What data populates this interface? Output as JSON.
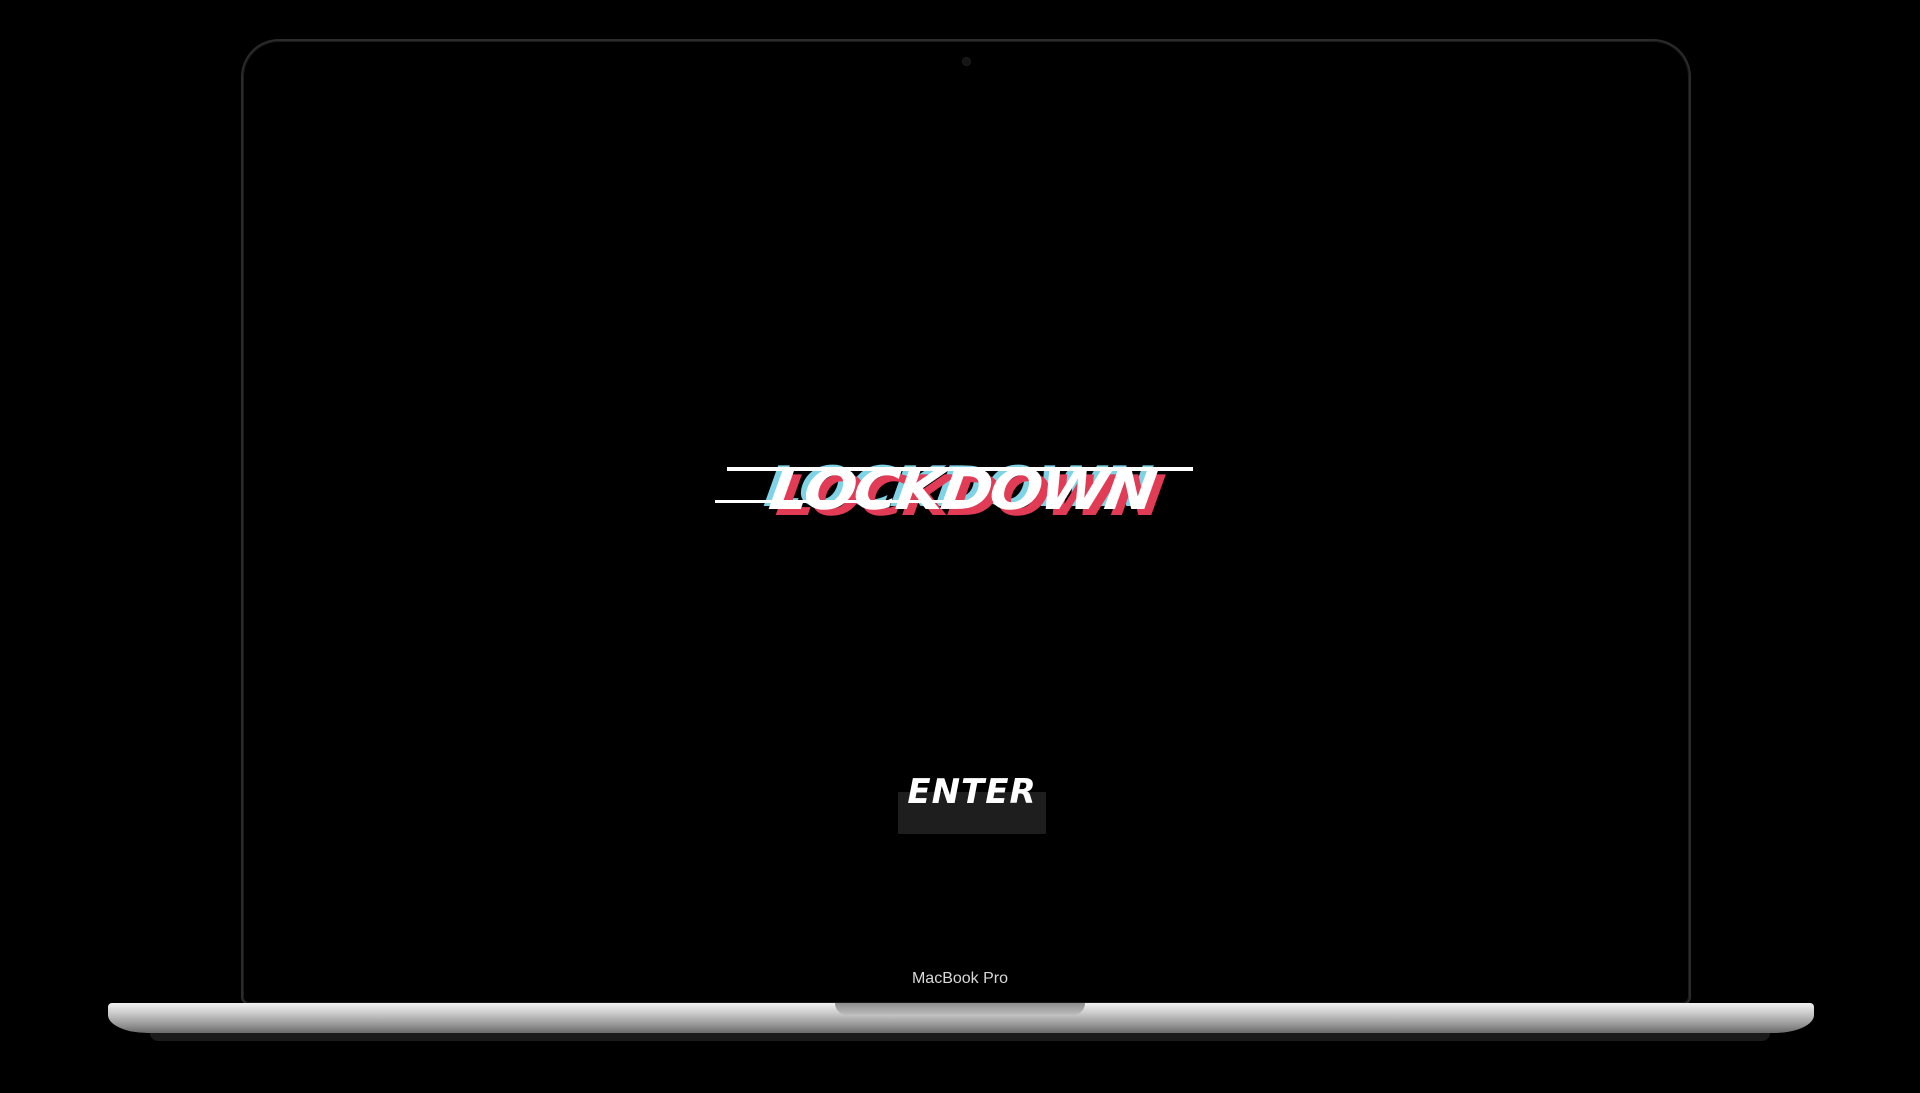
{
  "device": {
    "model_label": "MacBook Pro"
  },
  "landing": {
    "title": "LOCKDOWN",
    "enter_label": "ENTER"
  },
  "colors": {
    "background": "#000000",
    "glitch_red": "#e23b55",
    "glitch_cyan": "#7fd3e6",
    "text": "#ffffff",
    "button_bg": "#1e1e1e"
  }
}
